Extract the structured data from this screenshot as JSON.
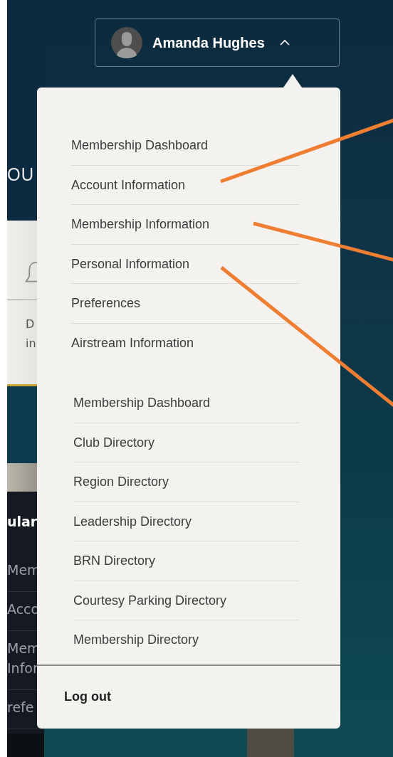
{
  "background": {
    "hero_heading": "OU",
    "card_lines": [
      "D",
      "in"
    ],
    "sidebar": {
      "heading": "ular",
      "items": [
        {
          "lines": [
            "Mem"
          ]
        },
        {
          "lines": [
            "Acco"
          ]
        },
        {
          "lines": [
            "Mem",
            "Infor"
          ]
        },
        {
          "lines": [
            "refe"
          ]
        }
      ]
    }
  },
  "user_button": {
    "name": "Amanda Hughes",
    "expanded": true
  },
  "menu": {
    "groups": [
      [
        "Membership Dashboard",
        "Account Information",
        "Membership Information",
        "Personal Information",
        "Preferences",
        "Airstream Information"
      ],
      [
        "Membership Dashboard",
        "Club Directory",
        "Region Directory",
        "Leadership Directory",
        "BRN Directory",
        "Courtesy Parking Directory",
        "Membership Directory"
      ]
    ],
    "logout": "Log out"
  }
}
